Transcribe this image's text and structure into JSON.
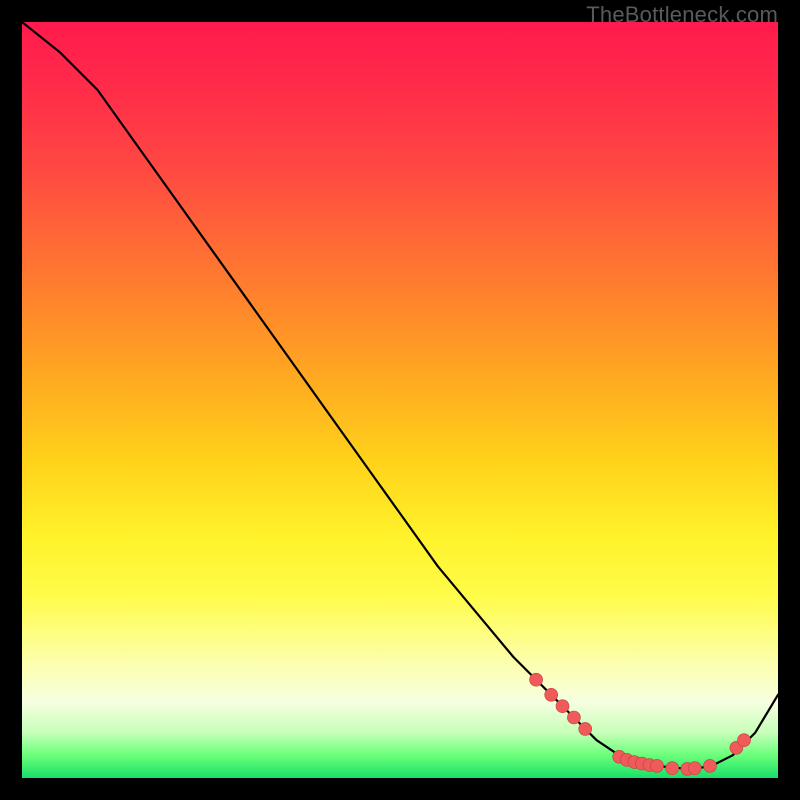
{
  "watermark": "TheBottleneck.com",
  "colors": {
    "dot_fill": "#ef5a5a",
    "dot_stroke": "#c24040",
    "line": "#000000"
  },
  "chart_data": {
    "type": "line",
    "title": "",
    "xlabel": "",
    "ylabel": "",
    "xlim": [
      0,
      100
    ],
    "ylim": [
      0,
      100
    ],
    "x": [
      0,
      5,
      10,
      15,
      20,
      25,
      30,
      35,
      40,
      45,
      50,
      55,
      60,
      65,
      70,
      73,
      76,
      79,
      82,
      85,
      88,
      91,
      94,
      97,
      100
    ],
    "values": [
      100,
      96,
      91,
      84,
      77,
      70,
      63,
      56,
      49,
      42,
      35,
      28,
      22,
      16,
      11,
      8,
      5,
      3,
      2,
      1.5,
      1.2,
      1.5,
      3,
      6,
      11
    ],
    "scatter_points": [
      {
        "x": 68,
        "y": 13
      },
      {
        "x": 70,
        "y": 11
      },
      {
        "x": 71.5,
        "y": 9.5
      },
      {
        "x": 73,
        "y": 8
      },
      {
        "x": 74.5,
        "y": 6.5
      },
      {
        "x": 79,
        "y": 2.8
      },
      {
        "x": 80,
        "y": 2.4
      },
      {
        "x": 81,
        "y": 2.1
      },
      {
        "x": 82,
        "y": 1.9
      },
      {
        "x": 83,
        "y": 1.7
      },
      {
        "x": 84,
        "y": 1.6
      },
      {
        "x": 86,
        "y": 1.3
      },
      {
        "x": 88,
        "y": 1.2
      },
      {
        "x": 89,
        "y": 1.3
      },
      {
        "x": 91,
        "y": 1.6
      },
      {
        "x": 94.5,
        "y": 4
      },
      {
        "x": 95.5,
        "y": 5
      }
    ],
    "note": "Values are read in chart-space where (0,0) is bottom-left and (100,100) is top-right; y is qualitative (no axis labels in source)."
  }
}
